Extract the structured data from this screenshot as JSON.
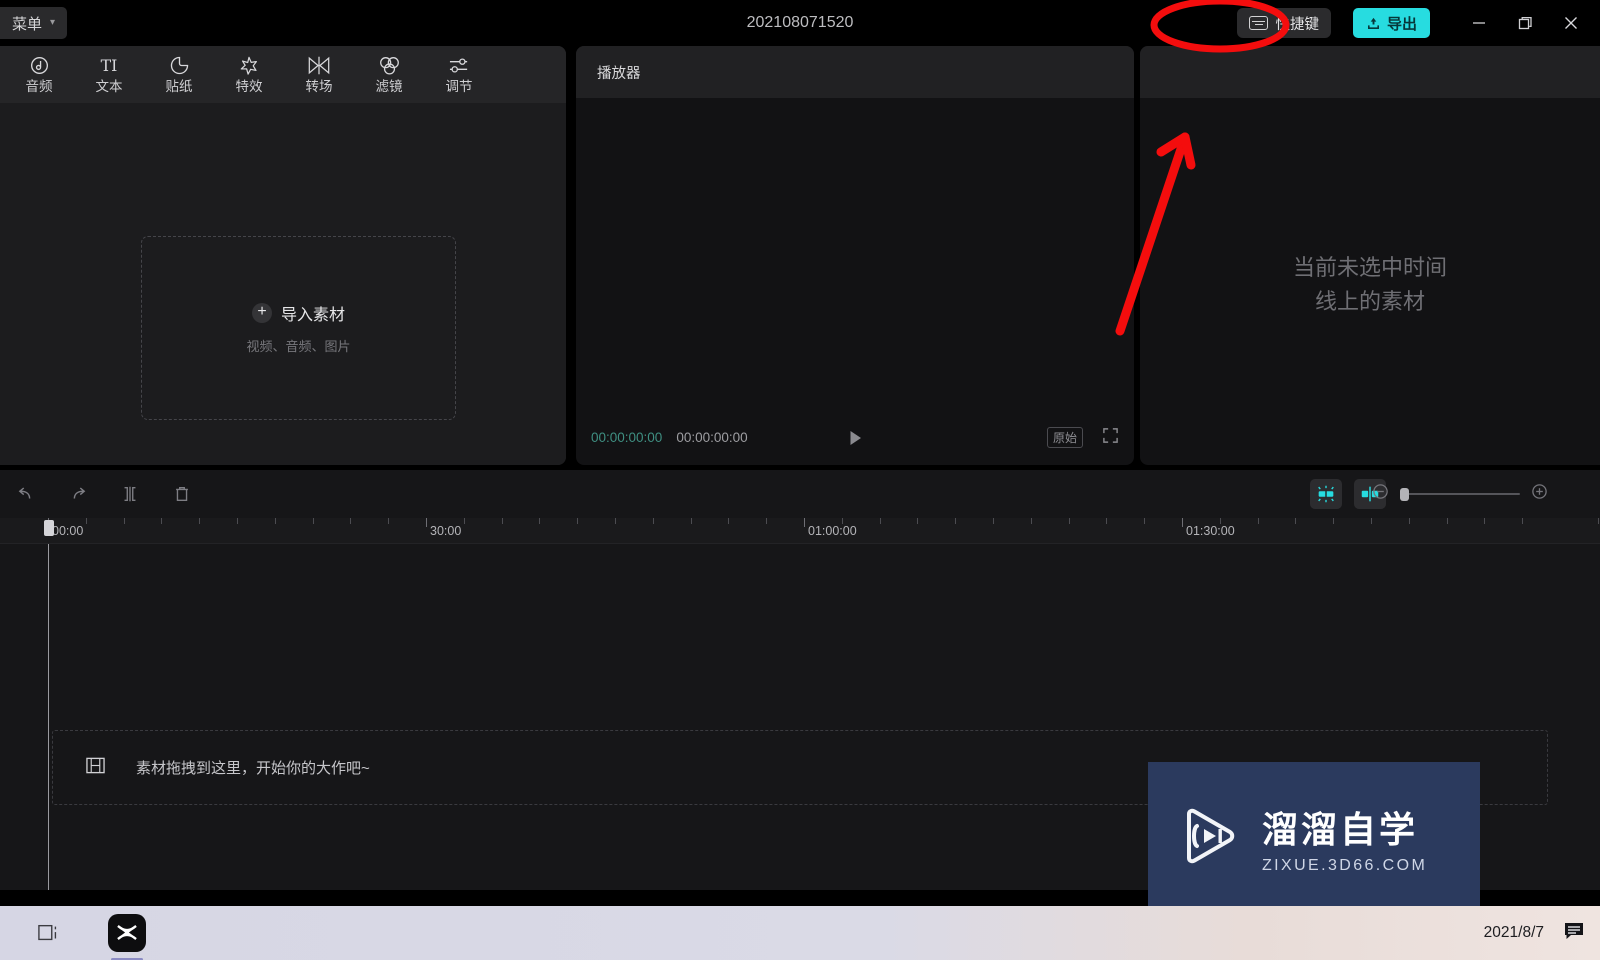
{
  "titlebar": {
    "menu_label": "菜单",
    "menu_caret": "chevron-down-icon",
    "window_title": "202108071520",
    "shortcut_label": "快捷键",
    "export_label": "导出",
    "minimize": "−",
    "maximize": "❐",
    "close": "✕"
  },
  "media_panel": {
    "tools": [
      {
        "label": "音频",
        "icon": "audio-icon"
      },
      {
        "label": "文本",
        "icon": "text-icon"
      },
      {
        "label": "贴纸",
        "icon": "sticker-icon"
      },
      {
        "label": "特效",
        "icon": "effects-icon"
      },
      {
        "label": "转场",
        "icon": "transition-icon"
      },
      {
        "label": "滤镜",
        "icon": "filter-icon"
      },
      {
        "label": "调节",
        "icon": "adjust-icon"
      }
    ],
    "dropbox": {
      "plus": "+",
      "title": "导入素材",
      "subtitle": "视频、音频、图片"
    }
  },
  "player": {
    "header_title": "播放器",
    "time_current": "00:00:00:00",
    "time_total": "00:00:00:00",
    "ratio_label": "原始"
  },
  "attributes": {
    "empty_line1": "当前未选中时间",
    "empty_line2": "线上的素材"
  },
  "timeline": {
    "tools": [
      {
        "name": "undo-button",
        "icon": "undo-icon"
      },
      {
        "name": "redo-button",
        "icon": "redo-icon"
      },
      {
        "name": "split-button",
        "icon": "split-icon"
      },
      {
        "name": "delete-button",
        "icon": "trash-icon"
      }
    ],
    "toggles": [
      {
        "name": "auto-snap-toggle",
        "icon": "snap-icon",
        "color": "#27dce0"
      },
      {
        "name": "mirror-toggle",
        "icon": "mirror-icon",
        "color": "#27dce0"
      }
    ],
    "zoom_out": "−",
    "zoom_in": "+",
    "ruler_labels": [
      "00:00",
      "30:00",
      "01:00:00",
      "01:30:00"
    ],
    "drop_hint": "素材拖拽到这里，开始你的大作吧~",
    "playhead_time": "00:00"
  },
  "watermark": {
    "title": "溜溜自学",
    "subtitle": "ZIXUE.3D66.COM"
  },
  "taskbar": {
    "date": "2021/8/7"
  },
  "colors": {
    "accent": "#27dce0",
    "annotation": "#f40d0d",
    "panel_bg": "#1c1c1e",
    "watermark_bg": "#2b3a5e"
  }
}
